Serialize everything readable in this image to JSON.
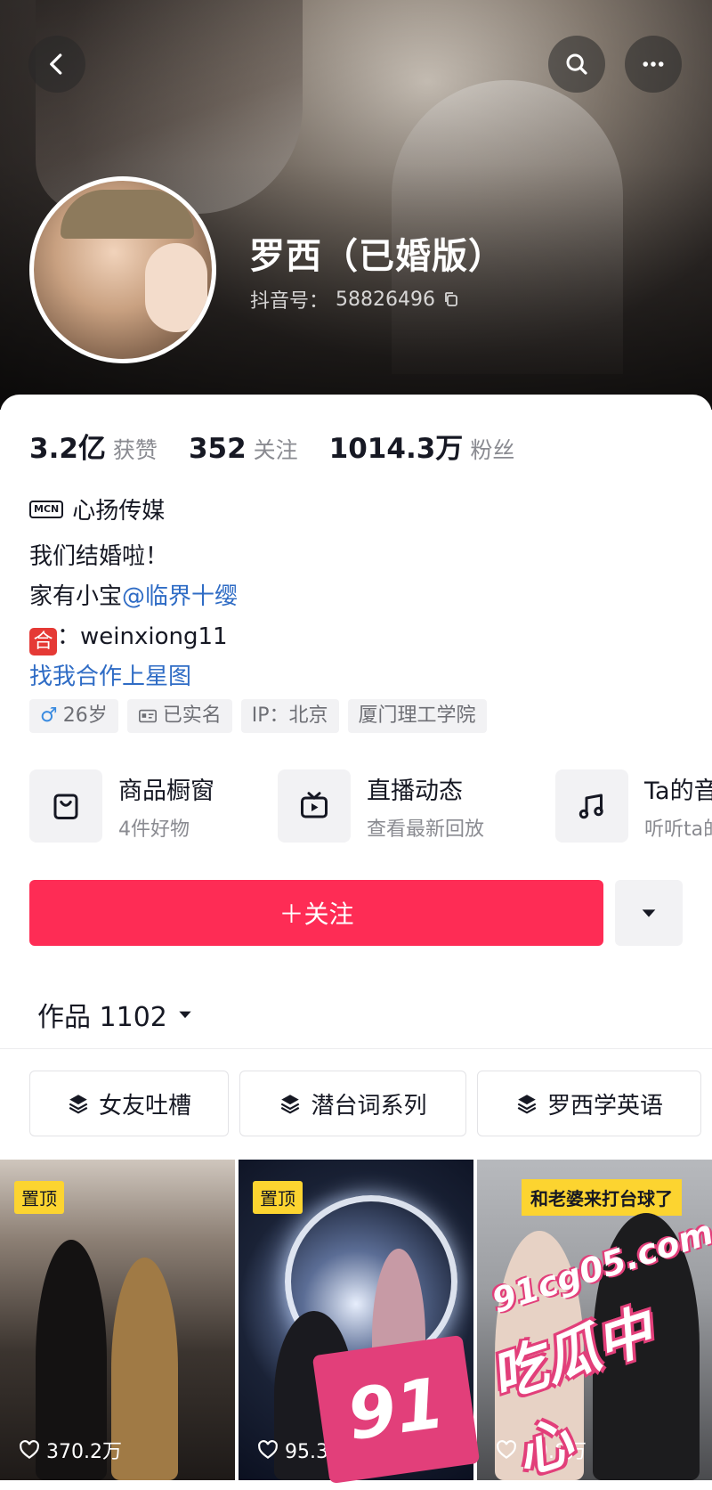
{
  "header": {
    "nickname": "罗西（已婚版）",
    "douyin_id_label": "抖音号：",
    "douyin_id": "58826496"
  },
  "stats": [
    {
      "num": "3.2亿",
      "label": "获赞"
    },
    {
      "num": "352",
      "label": "关注"
    },
    {
      "num": "1014.3万",
      "label": "粉丝"
    }
  ],
  "mcn": {
    "badge": "MCN",
    "name": "心扬传媒"
  },
  "bio": {
    "line1": "我们结婚啦！",
    "line2_prefix": "家有小宝",
    "line2_mention": "@临界十缨",
    "line3_badge": "合",
    "line3_text": "：weinxiong11",
    "line4_link": "找我合作上星图"
  },
  "tags": {
    "gender_symbol": "♂",
    "age": "26岁",
    "verified": "已实名",
    "ip": "IP：北京",
    "school": "厦门理工学院"
  },
  "features": [
    {
      "title": "商品橱窗",
      "sub": "4件好物",
      "icon": "bag-icon"
    },
    {
      "title": "直播动态",
      "sub": "查看最新回放",
      "icon": "tv-icon"
    },
    {
      "title": "Ta的音乐",
      "sub": "听听ta的音乐",
      "icon": "music-note-icon"
    }
  ],
  "actions": {
    "follow_label": "＋关注"
  },
  "works": {
    "label": "作品 1102"
  },
  "collections": [
    {
      "label": "女友吐槽"
    },
    {
      "label": "潜台词系列"
    },
    {
      "label": "罗西学英语"
    }
  ],
  "videos": [
    {
      "pin": "置顶",
      "likes": "370.2万"
    },
    {
      "pin": "置顶",
      "likes": "95.3万"
    },
    {
      "caption": "和老婆来打台球了",
      "likes": "19.8万"
    }
  ],
  "watermark": {
    "site": "91cg05.com",
    "name": "吃瓜中心",
    "num": "91"
  }
}
